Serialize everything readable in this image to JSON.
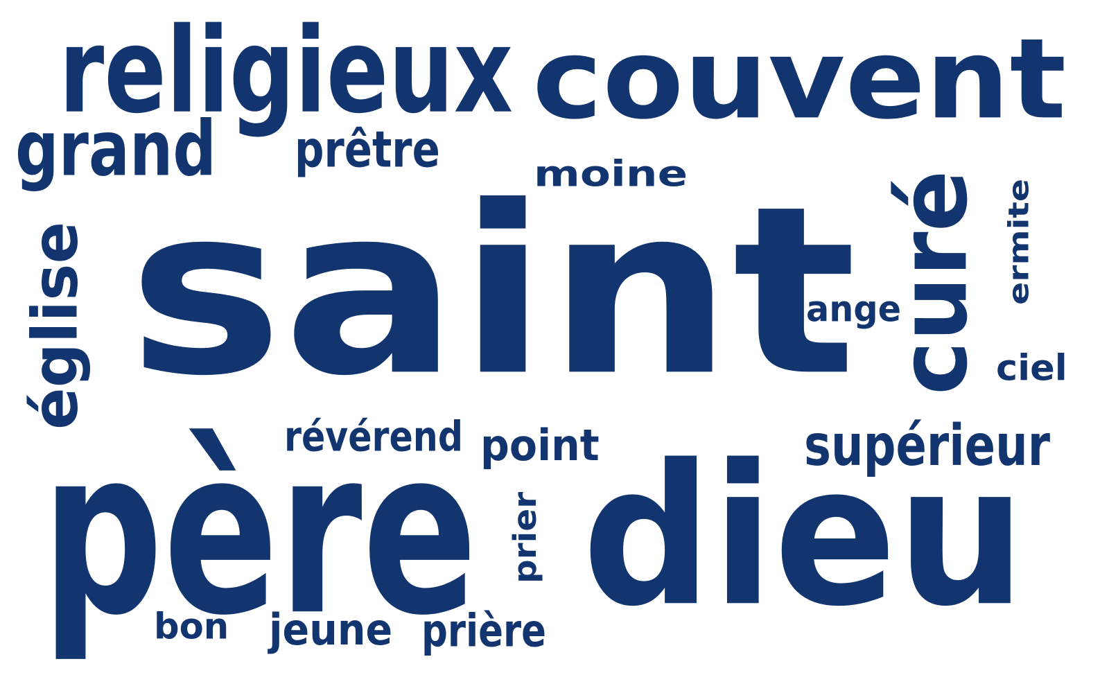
{
  "word_cloud": {
    "color": "#12346f",
    "background": "#ffffff",
    "words": [
      {
        "id": "saint",
        "text": "saint"
      },
      {
        "id": "pere",
        "text": "père"
      },
      {
        "id": "dieu",
        "text": "dieu"
      },
      {
        "id": "couvent",
        "text": "couvent"
      },
      {
        "id": "religieux",
        "text": "religieux"
      },
      {
        "id": "cure",
        "text": "curé"
      },
      {
        "id": "eglise",
        "text": "église"
      },
      {
        "id": "grand",
        "text": "grand"
      },
      {
        "id": "pretre",
        "text": "prêtre"
      },
      {
        "id": "moine",
        "text": "moine"
      },
      {
        "id": "ermite",
        "text": "ermite"
      },
      {
        "id": "ange",
        "text": "ange"
      },
      {
        "id": "ciel",
        "text": "ciel"
      },
      {
        "id": "reverend",
        "text": "révérend"
      },
      {
        "id": "point",
        "text": "point"
      },
      {
        "id": "superieur",
        "text": "supérieur"
      },
      {
        "id": "prier",
        "text": "prier"
      },
      {
        "id": "bon",
        "text": "bon"
      },
      {
        "id": "jeune",
        "text": "jeune"
      },
      {
        "id": "priere",
        "text": "prière"
      }
    ]
  }
}
